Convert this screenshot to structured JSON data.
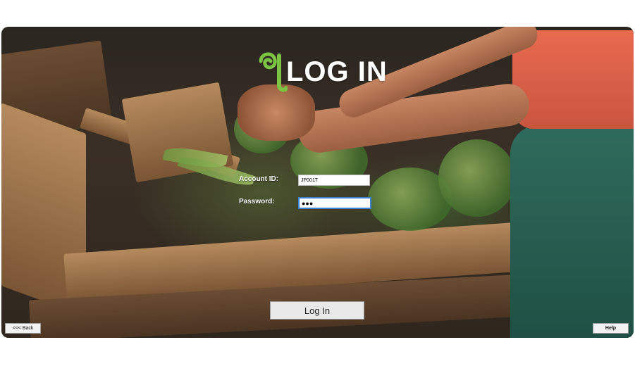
{
  "logo": {
    "title": "LOG IN"
  },
  "form": {
    "account_label": "Account ID:",
    "account_value": "JP001T",
    "password_label": "Password:",
    "password_value": "●●●"
  },
  "buttons": {
    "login": "Log In",
    "back": "<<< Back",
    "help": "Help"
  },
  "colors": {
    "logo_green": "#7cc243",
    "focus_border": "#3e7fd6"
  }
}
